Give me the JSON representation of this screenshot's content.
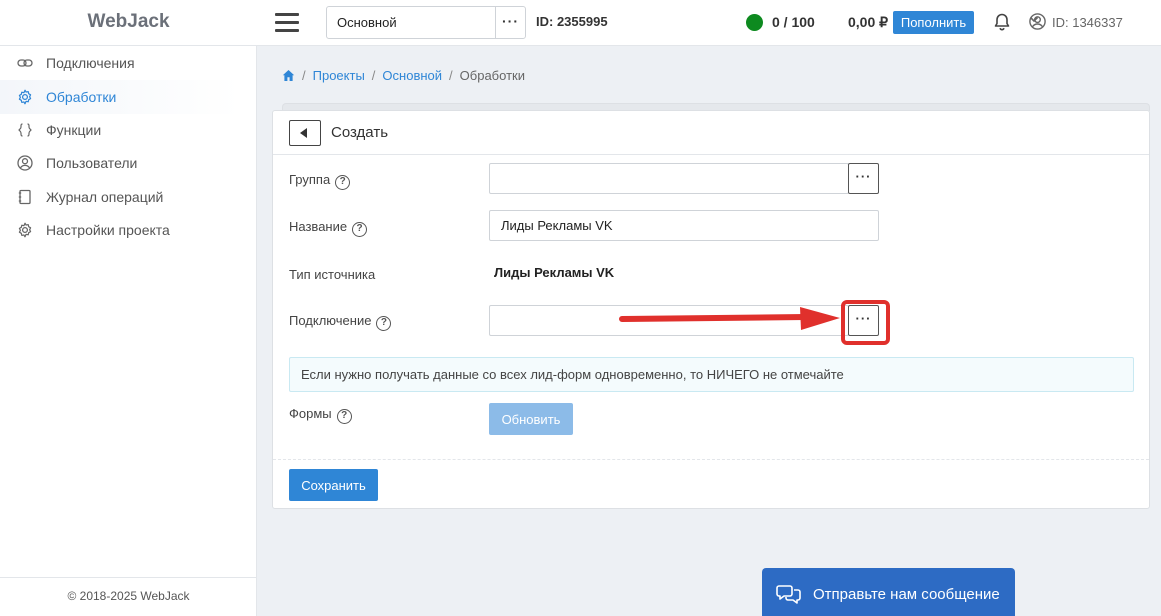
{
  "header": {
    "logo": "WebJack",
    "project_select": "Основной",
    "project_more": "···",
    "project_id": "ID: 2355995",
    "counter": "0 / 100",
    "balance": "0,00 ₽",
    "topup_label": "Пополнить",
    "user_id": "ID: 1346337",
    "colors": {
      "status": "#0d8a1f",
      "accent": "#2f86d6"
    }
  },
  "sidebar": {
    "items": [
      {
        "label": "Подключения",
        "icon": "link-icon"
      },
      {
        "label": "Обработки",
        "icon": "gear-icon",
        "active": true
      },
      {
        "label": "Функции",
        "icon": "braces-icon"
      },
      {
        "label": "Пользователи",
        "icon": "user-icon"
      },
      {
        "label": "Журнал операций",
        "icon": "journal-icon"
      },
      {
        "label": "Настройки проекта",
        "icon": "gear-icon"
      }
    ],
    "footer": "© 2018-2025 WebJack"
  },
  "breadcrumb": {
    "items": [
      "Проекты",
      "Основной",
      "Обработки"
    ],
    "sep": "/"
  },
  "form": {
    "title": "Создать",
    "group": {
      "label": "Группа",
      "value": ""
    },
    "name": {
      "label": "Название",
      "value": "Лиды Рекламы VK"
    },
    "source_type": {
      "label": "Тип источника",
      "value": "Лиды Рекламы VK"
    },
    "connection": {
      "label": "Подключение",
      "value": ""
    },
    "more": "···",
    "qmark": "?",
    "info": "Если нужно получать данные со всех лид-форм одновременно, то НИЧЕГО не отмечайте",
    "forms": {
      "label": "Формы"
    },
    "refresh_label": "Обновить",
    "save_label": "Сохранить",
    "highlight_color": "#e0302c"
  },
  "chat": {
    "label": "Отправьте нам сообщение"
  }
}
